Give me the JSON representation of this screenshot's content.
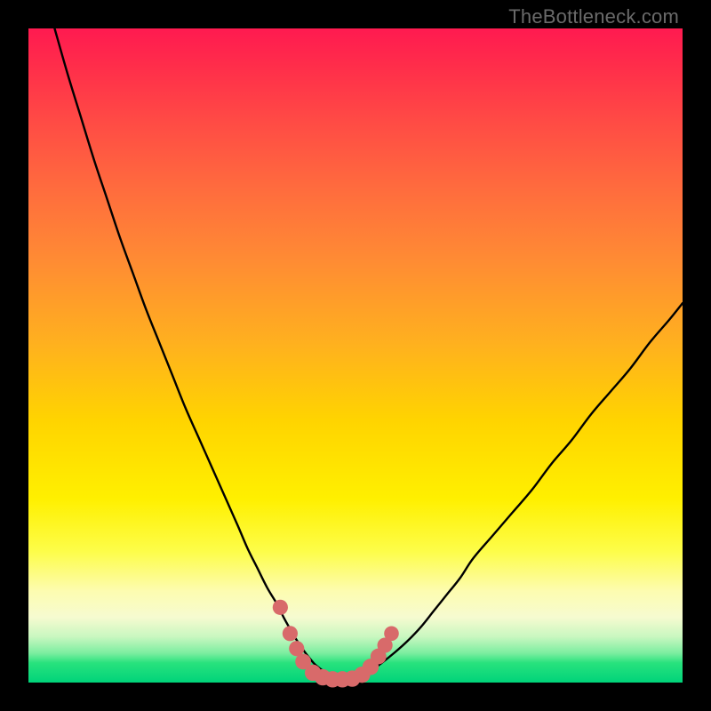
{
  "watermark": "TheBottleneck.com",
  "colors": {
    "frame": "#000000",
    "curve_stroke": "#000000",
    "marker_fill": "#d86a6a",
    "marker_stroke": "#d86a6a"
  },
  "chart_data": {
    "type": "line",
    "title": "",
    "xlabel": "",
    "ylabel": "",
    "xlim": [
      0,
      100
    ],
    "ylim": [
      0,
      100
    ],
    "grid": false,
    "legend": false,
    "series": [
      {
        "name": "left-branch",
        "x": [
          4,
          6,
          8,
          10,
          12,
          14,
          16,
          18,
          20,
          22,
          24,
          26,
          28,
          30,
          32,
          33.5,
          35,
          36.5,
          38,
          39,
          40,
          41,
          42,
          43,
          44,
          46,
          48
        ],
        "y": [
          100,
          93,
          86.5,
          80,
          74,
          68,
          62.5,
          57,
          52,
          47,
          42,
          37.5,
          33,
          28.5,
          24,
          20.5,
          17.5,
          14.5,
          12,
          10,
          8.2,
          6.5,
          5,
          3.7,
          2.6,
          1.2,
          0.5
        ]
      },
      {
        "name": "right-branch",
        "x": [
          48,
          50,
          52,
          54,
          56,
          58,
          60,
          62,
          64,
          66,
          68,
          71,
          74,
          77,
          80,
          83,
          86,
          89,
          92,
          95,
          98,
          100
        ],
        "y": [
          0.5,
          0.8,
          1.6,
          3.0,
          4.6,
          6.4,
          8.5,
          11,
          13.5,
          16,
          19,
          22.5,
          26,
          29.5,
          33.5,
          37,
          41,
          44.5,
          48,
          52,
          55.5,
          58
        ]
      }
    ],
    "markers": {
      "name": "bottom-markers",
      "points": [
        {
          "x": 38.5,
          "y": 11.5,
          "r": 1.2
        },
        {
          "x": 40,
          "y": 7.5,
          "r": 1.2
        },
        {
          "x": 41,
          "y": 5.2,
          "r": 1.2
        },
        {
          "x": 42,
          "y": 3.2,
          "r": 1.3
        },
        {
          "x": 43.5,
          "y": 1.5,
          "r": 1.4
        },
        {
          "x": 45,
          "y": 0.8,
          "r": 1.4
        },
        {
          "x": 46.5,
          "y": 0.5,
          "r": 1.4
        },
        {
          "x": 48,
          "y": 0.5,
          "r": 1.4
        },
        {
          "x": 49.5,
          "y": 0.6,
          "r": 1.4
        },
        {
          "x": 51,
          "y": 1.2,
          "r": 1.4
        },
        {
          "x": 52.3,
          "y": 2.4,
          "r": 1.4
        },
        {
          "x": 53.5,
          "y": 4.0,
          "r": 1.3
        },
        {
          "x": 54.5,
          "y": 5.7,
          "r": 1.2
        },
        {
          "x": 55.5,
          "y": 7.5,
          "r": 1.1
        }
      ]
    }
  }
}
